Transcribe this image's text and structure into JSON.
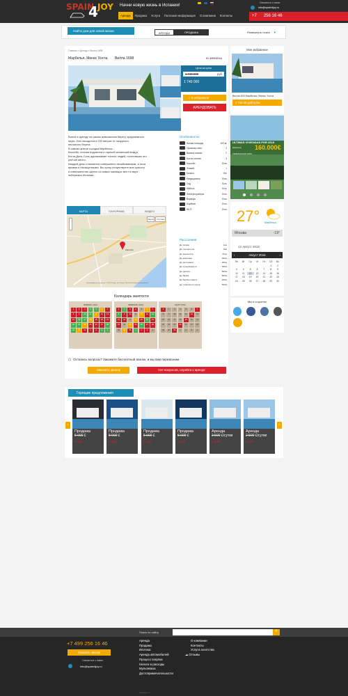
{
  "header": {
    "tagline": "Начни новую жизнь в Испании!",
    "nav": [
      "Аренда",
      "Продажа",
      "Услуги",
      "Полезная информация",
      "О компании",
      "Контакты"
    ],
    "nav_active": 0,
    "contact_text": "Связаться с нами:",
    "email": "info@spain4joy.ru",
    "phone_code": "+7",
    "phone_number": "256 16 46"
  },
  "searchbar": {
    "cta": "Найти дом для новой жизни",
    "tab_rent": "АРЕНДА",
    "tab_sale": "ПРОДАЖА",
    "expand": "Развернуть поиск"
  },
  "property": {
    "breadcrumbs": "Главная » Аренда » Вилла 1698",
    "location": "Марбелья, Минас Хоста.",
    "name": "Вилла 1698",
    "id": "ID 48903516",
    "price_label": "Цена за сутки",
    "price_old": "1 740 000",
    "price_currency": "руб",
    "price_new": "1 740 000",
    "fav_label": "В избранное",
    "rent_label": "АРЕНДОВАТЬ",
    "description": [
      "Вилла в аренду на самом живописном берегу средиземного",
      "моря. Она находится в 200 метрах от лазурного",
      "песчаного берега.",
      "В самом центре городка Марбелья...",
      "Бассейн, ночная подсветка и горячий испанский воздух",
      "Коста-Дель-Соль адоназывает тысячи людей, посетивших это",
      "уютное место.",
      "Каждый день становится совершенно незабываемым, а ночи",
      "яркими и насыщенными. Вы сразу почувствуете всю красоту",
      "и совершенство одного из самых манящих мест в мире -",
      "побережья Испании..."
    ],
    "features_title": "Особенности:",
    "features": [
      {
        "name": "Жилая площадь",
        "value": "109 м²"
      },
      {
        "name": "Гаражных мест",
        "value": "3"
      },
      {
        "name": "Ванных комнат",
        "value": "2"
      },
      {
        "name": "Кол-во спален",
        "value": "3"
      },
      {
        "name": "Бассейн",
        "value": "Есть"
      },
      {
        "name": "Этажей",
        "value": "1"
      },
      {
        "name": "Балкон",
        "value": "Нет"
      },
      {
        "name": "Кондиционер",
        "value": "Есть"
      },
      {
        "name": "Сад",
        "value": "Есть"
      },
      {
        "name": "Мебель",
        "value": "Есть"
      },
      {
        "name": "Электроприборы",
        "value": "Есть"
      },
      {
        "name": "Веранда",
        "value": "Есть"
      },
      {
        "name": "Барбекю",
        "value": "Есть"
      },
      {
        "name": "Wi-Fi",
        "value": "Есть"
      }
    ],
    "distance_title": "Расстояние:",
    "distances": [
      {
        "name": "До пляжа",
        "value": "1км"
      },
      {
        "name": "До гольф-поля",
        "value": "3км"
      },
      {
        "name": "До аэропорта",
        "value": "47км"
      },
      {
        "name": "До магазина",
        "value": "300м"
      },
      {
        "name": "До ресторана",
        "value": "200м"
      },
      {
        "name": "До супермаркета",
        "value": "300м"
      },
      {
        "name": "До центра",
        "value": "500м"
      },
      {
        "name": "До банка",
        "value": "500м"
      },
      {
        "name": "До барбюстранта",
        "value": "200м"
      },
      {
        "name": "До теннисного корта",
        "value": "500м"
      }
    ],
    "map_tabs": [
      "КАРТА",
      "ПАНОРАМА",
      "ВИДЕО"
    ],
    "map_place": "Marbella",
    "map_controls": [
      "Карта",
      "Спутник"
    ],
    "map_attribution": "Картографические данные © 2015 Google, Inst. Geogr. Nacional   Условия использования",
    "calendar_title": "Календарь занятости",
    "calendars": [
      {
        "month": "ЯНВАРЬ 2014"
      },
      {
        "month": "ФЕВРАЛЬ 2014"
      },
      {
        "month": "МАРТ 2014"
      }
    ],
    "callback_text": "Остались вопросы? Закажите бесплатный звонок, и мы вам перезвоним.",
    "call_btn": "Заказать звонок",
    "no_btn": "Нет вопросов, перейти к аренде"
  },
  "sidebar": {
    "fav_title": "Мое избранное",
    "fav_caption": "Вилла 609 Марбелья, Минас Хоста",
    "fav_price": "1 740 00 руб/сутки",
    "ad_title": "ULTIMAS VIVIENDAS POR 2015",
    "ad_sub": "Estepona",
    "ad_price": "160.000€",
    "ad_note": "FINANCIACION 100%",
    "weather_temp": "27°",
    "weather_city": "Марбелья",
    "moscow_label": "Москва",
    "moscow_temp": "-19°",
    "date_line": "12 Август 2015",
    "cal_month": "Август 2015",
    "cal_days": [
      "Пн",
      "Вт",
      "Ср",
      "Чт",
      "Пт",
      "Сб",
      "Вс"
    ],
    "social_title": "Мы в соцсетях"
  },
  "hot": {
    "title": "Горящие предложения",
    "offers": [
      {
        "title": "Продажа",
        "price": "5 000",
        "currency": "£",
        "old": "5 000"
      },
      {
        "title": "Продажа",
        "price": "5 000",
        "currency": "£",
        "old": "5 000"
      },
      {
        "title": "Продажа",
        "price": "5 000",
        "currency": "£",
        "old": "5 000"
      },
      {
        "title": "Продажа",
        "price": "5 000",
        "currency": "£",
        "old": "5 000"
      },
      {
        "title": "Аренда",
        "price": "2 500",
        "currency": "£/сутки",
        "old": "5 000"
      },
      {
        "title": "Аренда",
        "price": "2 500",
        "currency": "£/сутки",
        "old": "5 000"
      }
    ]
  },
  "footer": {
    "search_label": "Поиск по сайту",
    "phone": "+7 499 256 16 46",
    "call_btn": "Заказать звонок",
    "contact_text": "Связаться с нами:",
    "email": "info@spain4joy.ru",
    "col1": [
      "Аренда",
      "Продажа",
      "Ипотека",
      "Аренда автомобилей",
      "Процесс покупки",
      "Налоги и расходы",
      "Мультивиза",
      "Достопримечательности"
    ],
    "col2": [
      "О компании",
      "Контакты",
      "Услуги агентства",
      "Отзывы"
    ],
    "copyright": "Spain4joy.ru"
  },
  "colors": {
    "accent_yellow": "#f2a900",
    "accent_red": "#d9202b",
    "accent_blue": "#1d8fb6"
  }
}
